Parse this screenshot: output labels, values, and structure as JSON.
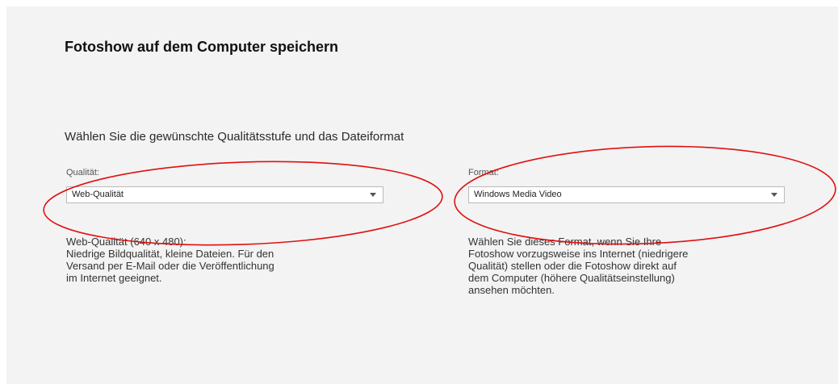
{
  "dialog": {
    "title": "Fotoshow auf dem Computer speichern",
    "subtitle": "Wählen Sie die gewünschte Qualitätsstufe und das Dateiformat"
  },
  "quality": {
    "label": "Qualität:",
    "selected": "Web-Qualität",
    "description": "Web-Qualität (640 x 480):\nNiedrige Bildqualität, kleine Dateien. Für den\nVersand per E-Mail oder die Veröffentlichung\nim Internet geeignet."
  },
  "format": {
    "label": "Format:",
    "selected": "Windows Media Video",
    "description": "Wählen Sie dieses Format, wenn Sie Ihre\nFotoshow vorzugsweise ins Internet (niedrigere\nQualität) stellen oder die Fotoshow direkt auf\ndem Computer (höhere Qualitätseinstellung)\nansehen möchten."
  },
  "annotation": {
    "color": "#e01010"
  },
  "icons": {
    "dropdown": "chevron-down-icon"
  }
}
